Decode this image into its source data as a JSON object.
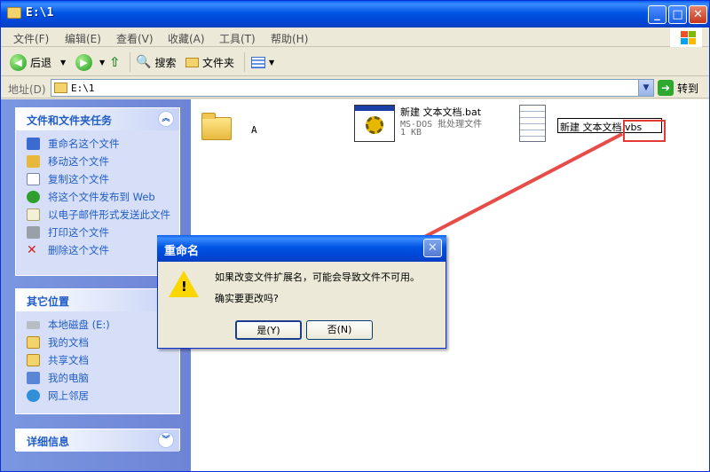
{
  "window": {
    "title": "E:\\1",
    "min": "_",
    "max": "□",
    "close": "✕"
  },
  "menu": [
    "文件(F)",
    "编辑(E)",
    "查看(V)",
    "收藏(A)",
    "工具(T)",
    "帮助(H)"
  ],
  "toolbar": {
    "back": "后退",
    "search": "搜索",
    "folders": "文件夹"
  },
  "address": {
    "label": "地址(D)",
    "value": "E:\\1",
    "go": "转到"
  },
  "tasks": {
    "title": "文件和文件夹任务",
    "items": [
      "重命名这个文件",
      "移动这个文件",
      "复制这个文件",
      "将这个文件发布到 Web",
      "以电子邮件形式发送此文件",
      "打印这个文件",
      "删除这个文件"
    ]
  },
  "places": {
    "title": "其它位置",
    "items": [
      "本地磁盘 (E:)",
      "我的文档",
      "共享文档",
      "我的电脑",
      "网上邻居"
    ]
  },
  "details": {
    "title": "详细信息"
  },
  "files": [
    {
      "name": "A"
    },
    {
      "name": "新建 文本文档.bat",
      "type": "MS-DOS 批处理文件",
      "size": "1 KB"
    },
    {
      "name": "新建 文本文档.vbs"
    }
  ],
  "dialog": {
    "title": "重命名",
    "message": "如果改变文件扩展名，可能会导致文件不可用。",
    "question": "确实要更改吗?",
    "yes": "是(Y)",
    "no": "否(N)"
  },
  "colors": {
    "annotation": "#e53935",
    "titlebar": "#0054e3",
    "taskpane": "#6e84d6"
  }
}
